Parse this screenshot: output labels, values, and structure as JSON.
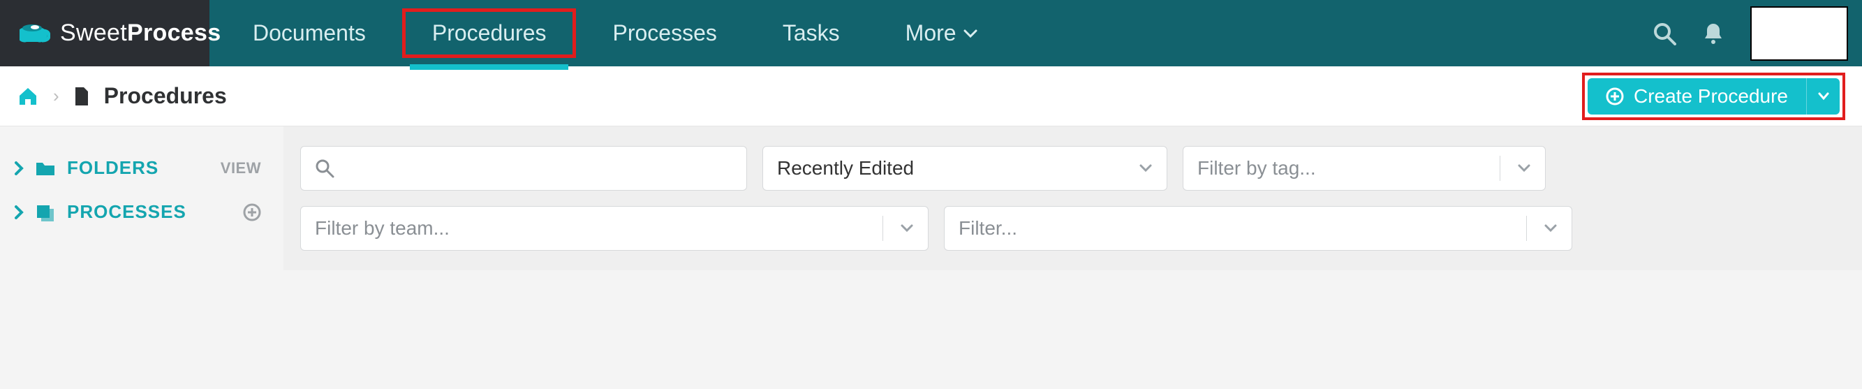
{
  "brand": {
    "name_light": "Sweet",
    "name_bold": "Process"
  },
  "nav": {
    "items": [
      {
        "label": "Documents"
      },
      {
        "label": "Procedures",
        "active": true
      },
      {
        "label": "Processes"
      },
      {
        "label": "Tasks"
      },
      {
        "label": "More"
      }
    ]
  },
  "breadcrumb": {
    "title": "Procedures"
  },
  "create_button": {
    "label": "Create Procedure"
  },
  "sidebar": {
    "folders": {
      "label": "FOLDERS",
      "action": "VIEW"
    },
    "processes": {
      "label": "PROCESSES",
      "action_icon": "plus"
    }
  },
  "filters": {
    "search_placeholder": "",
    "sort_value": "Recently Edited",
    "tag_placeholder": "Filter by tag...",
    "team_placeholder": "Filter by team...",
    "filter_placeholder": "Filter..."
  }
}
